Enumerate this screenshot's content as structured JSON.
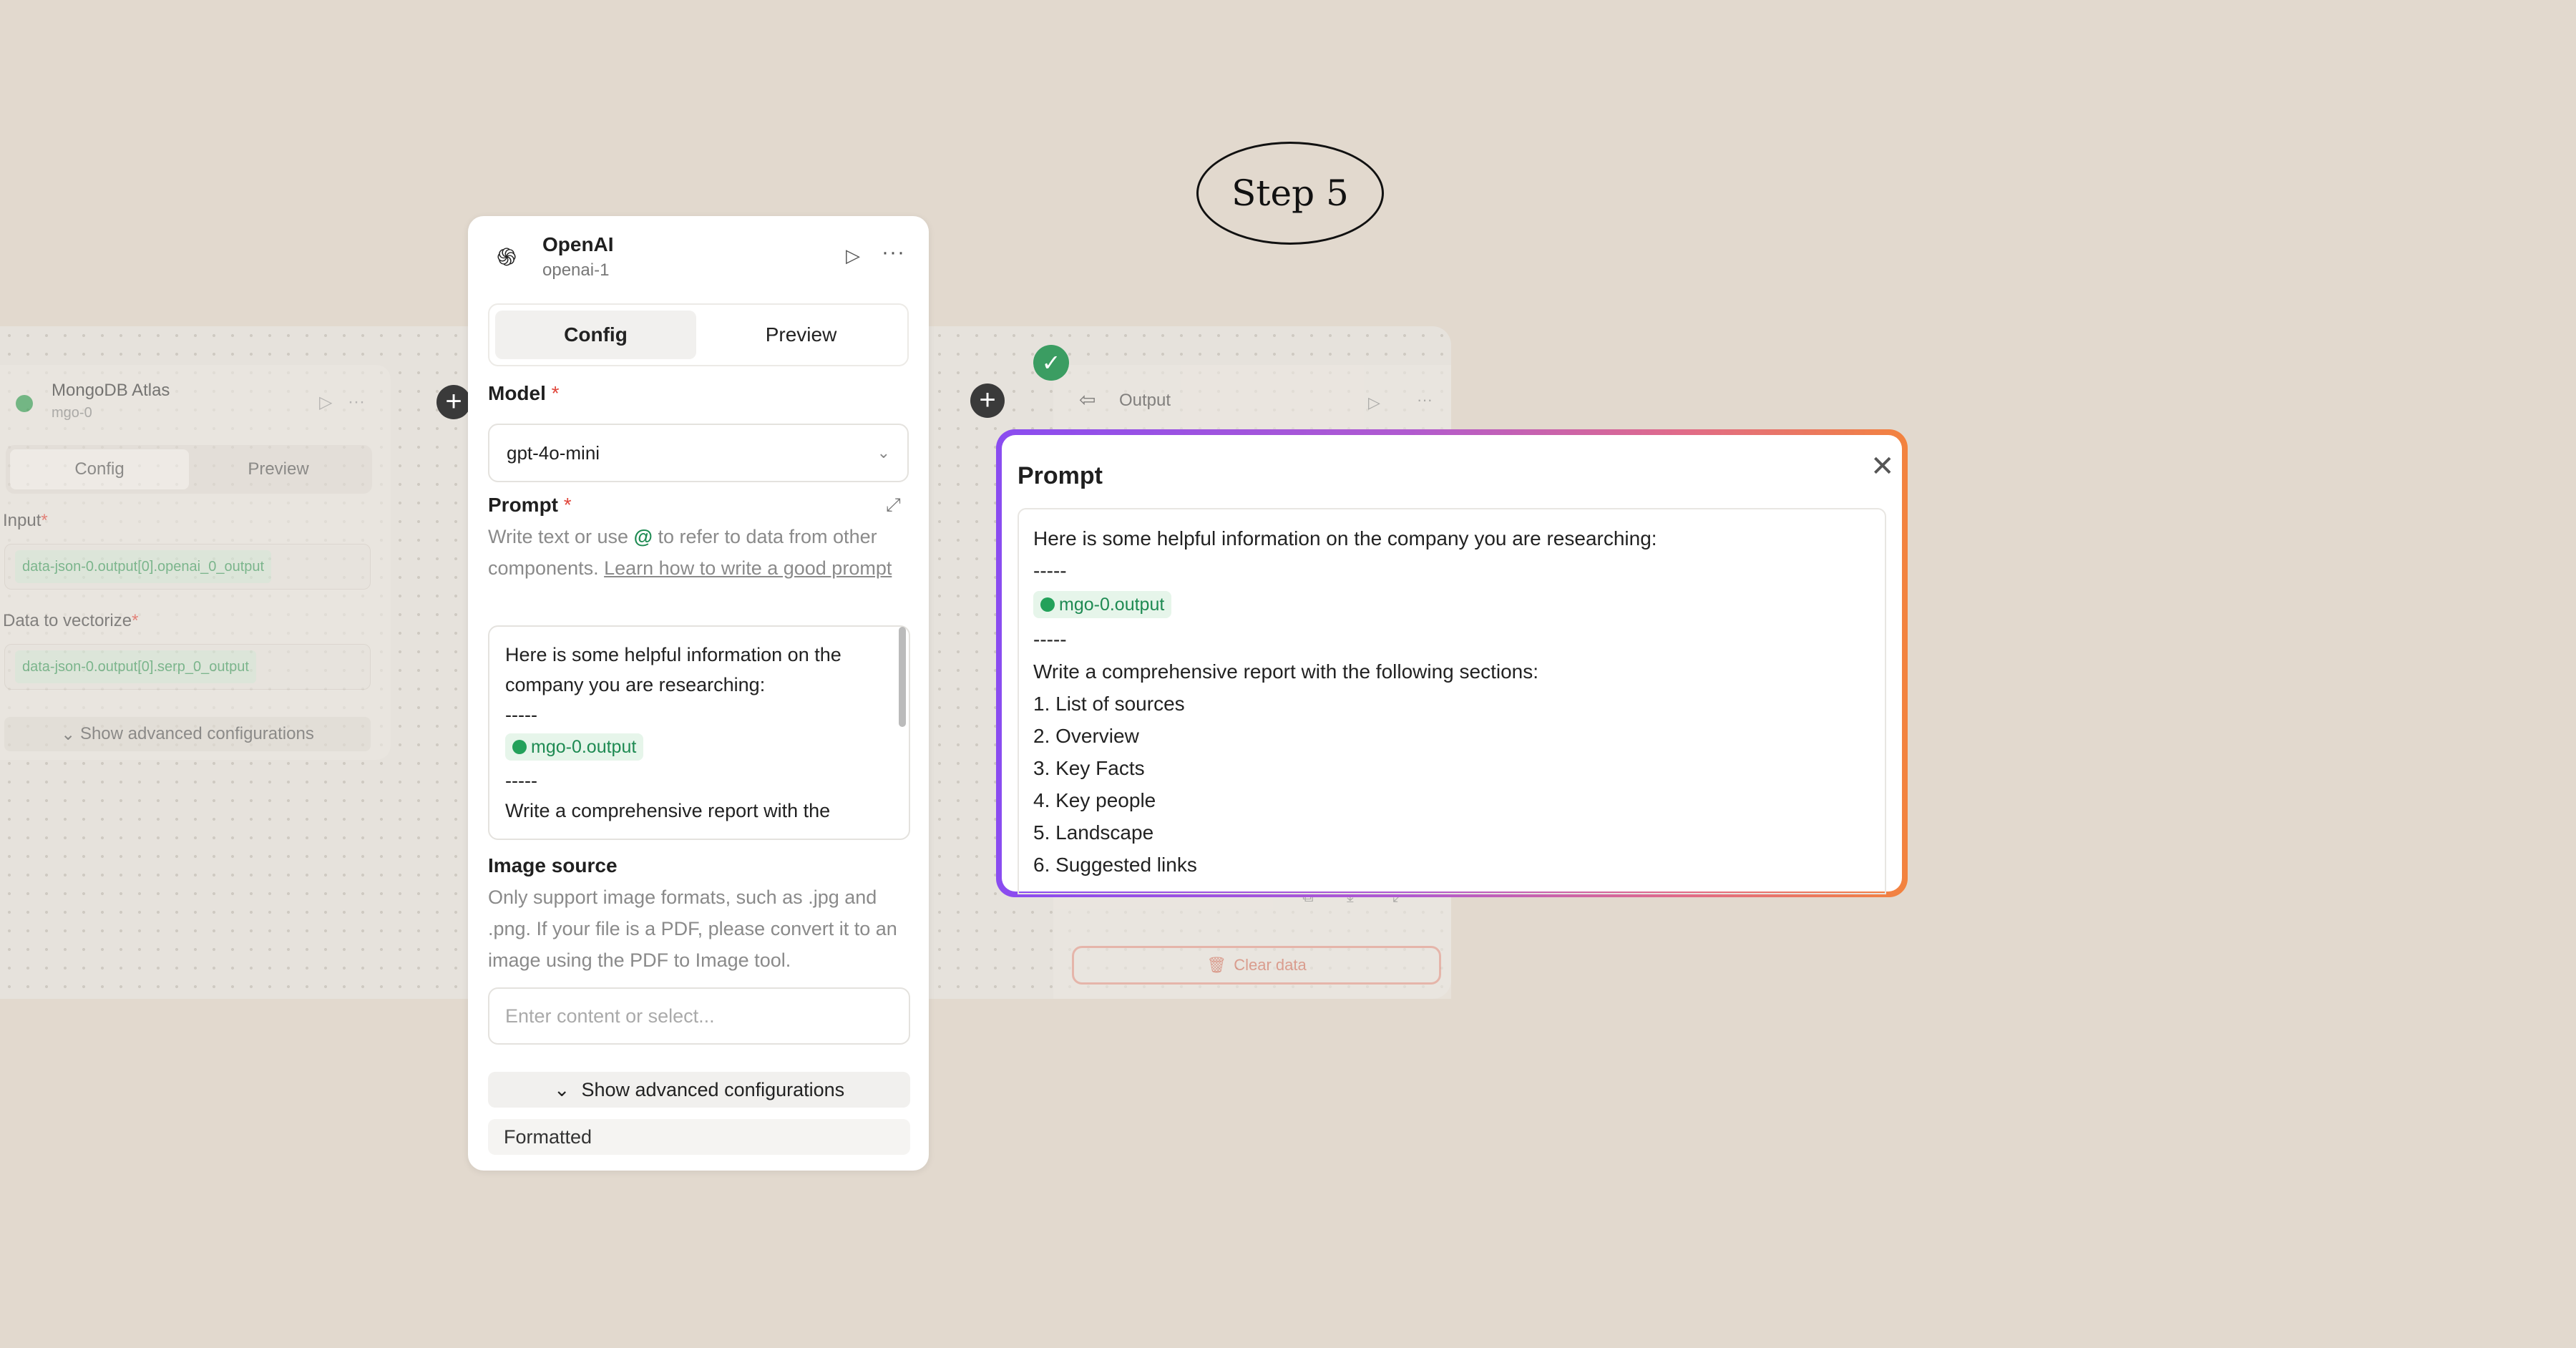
{
  "step_label": "Step 5",
  "mongo_card": {
    "title": "MongoDB Atlas",
    "subtitle": "mgo-0",
    "tabs": [
      "Config",
      "Preview"
    ],
    "input_label": "Input",
    "input_value": "data-json-0.output[0].openai_0_output",
    "vectorize_label": "Data to vectorize",
    "vectorize_value": "data-json-0.output[0].serp_0_output",
    "advanced_label": "Show advanced configurations"
  },
  "output_card": {
    "title": "Output",
    "clear_label": "Clear data"
  },
  "openai_panel": {
    "title": "OpenAI",
    "subtitle": "openai-1",
    "tabs": [
      "Config",
      "Preview"
    ],
    "active_tab": "Config",
    "model_label": "Model",
    "model_value": "gpt-4o-mini",
    "prompt_label": "Prompt",
    "prompt_help_1": "Write text or use",
    "prompt_help_at": "@",
    "prompt_help_2": "to refer to data from other components.",
    "prompt_help_link": "Learn how to write a good prompt",
    "prompt_lines": [
      "Here is some helpful information on the company you are researching:",
      "-----",
      "mgo-0.output",
      "-----",
      "Write a comprehensive report with the"
    ],
    "image_source_label": "Image source",
    "image_source_help": "Only support image formats, such as .jpg and .png. If your file is a PDF, please convert it to an image using the PDF to Image tool.",
    "image_source_placeholder": "Enter content or select...",
    "advanced_label": "Show advanced configurations",
    "formatted_label": "Formatted"
  },
  "prompt_modal": {
    "title": "Prompt",
    "lines": [
      "Here is some helpful information on the company you are researching:",
      "-----",
      "mgo-0.output",
      "-----",
      "Write a comprehensive report with the following sections:",
      "1. List of sources",
      "2. Overview",
      "3. Key Facts",
      "4. Key people",
      "5. Landscape",
      "6. Suggested links"
    ]
  },
  "colors": {
    "accent_green": "#1e8a52",
    "gradient_start": "#8a4cf0",
    "gradient_end": "#f3833e",
    "background": "#e2d9ce"
  }
}
